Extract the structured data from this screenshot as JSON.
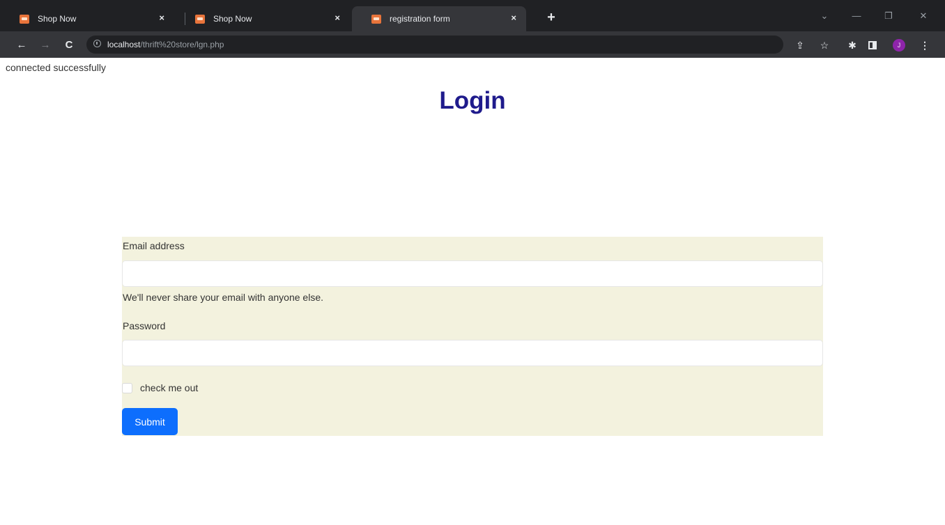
{
  "browser": {
    "tabs": [
      {
        "title": "Shop Now",
        "close": "×"
      },
      {
        "title": "Shop Now",
        "close": "×"
      },
      {
        "title": "registration form",
        "close": "×"
      }
    ],
    "new_tab": "+",
    "window_controls": {
      "tab_search": "⌄",
      "minimize": "—",
      "restore": "❐",
      "close": "✕"
    },
    "nav": {
      "back": "←",
      "forward": "→",
      "reload": "C"
    },
    "address": {
      "host": "localhost",
      "path": "/thrift%20store/lgn.php"
    },
    "toolbar_icons": {
      "share": "⇪",
      "bookmark": "☆",
      "extensions": "✱"
    },
    "avatar_initial": "J"
  },
  "page": {
    "status": "connected successfully",
    "title": "Login",
    "form": {
      "email_label": "Email address",
      "email_value": "",
      "email_help": "We'll never share your email with anyone else.",
      "password_label": "Password",
      "password_value": "",
      "check_label": "check me out",
      "submit_label": "Submit"
    }
  },
  "colors": {
    "title": "#1f1b8c",
    "form_background": "#f3f2de",
    "submit": "#0d6efd",
    "chrome_dark": "#202124",
    "chrome_toolbar": "#35363a"
  }
}
